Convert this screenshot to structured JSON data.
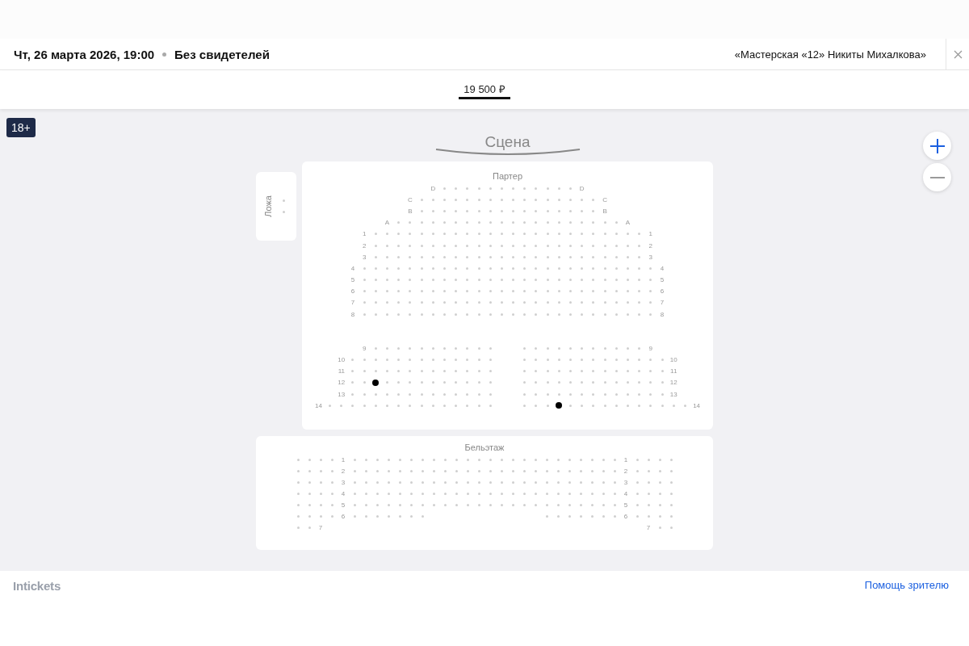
{
  "header": {
    "date": "Чт, 26 марта 2026, 19:00",
    "show": "Без свидетелей",
    "venue": "«Мастерская «12» Никиты Михалкова»"
  },
  "price_tabs": [
    {
      "label": "19 500 ₽",
      "selected": true
    }
  ],
  "age_badge": "18+",
  "stage": "Сцена",
  "loge": {
    "title": "Ложа",
    "seats": [
      false,
      false
    ]
  },
  "sections": [
    {
      "title": "Партер",
      "groups": [
        {
          "rows": [
            {
              "cells": [
                "D",
                false,
                false,
                false,
                false,
                false,
                false,
                false,
                false,
                false,
                false,
                false,
                false,
                "D"
              ]
            },
            {
              "cells": [
                "C",
                false,
                false,
                false,
                false,
                false,
                false,
                false,
                false,
                false,
                false,
                false,
                false,
                false,
                false,
                false,
                false,
                "C"
              ]
            },
            {
              "cells": [
                "B",
                false,
                false,
                false,
                false,
                false,
                false,
                false,
                false,
                false,
                false,
                false,
                false,
                false,
                false,
                false,
                false,
                "B"
              ]
            },
            {
              "cells": [
                "A",
                false,
                false,
                false,
                false,
                false,
                false,
                false,
                false,
                false,
                false,
                false,
                false,
                false,
                false,
                false,
                false,
                false,
                false,
                false,
                false,
                "A"
              ]
            },
            {
              "cells": [
                "1",
                false,
                false,
                false,
                false,
                false,
                false,
                false,
                false,
                false,
                false,
                false,
                false,
                false,
                false,
                false,
                false,
                false,
                false,
                false,
                false,
                false,
                false,
                false,
                false,
                "1"
              ]
            },
            {
              "cells": [
                "2",
                false,
                false,
                false,
                false,
                false,
                false,
                false,
                false,
                false,
                false,
                false,
                false,
                false,
                false,
                false,
                false,
                false,
                false,
                false,
                false,
                false,
                false,
                false,
                false,
                "2"
              ]
            },
            {
              "cells": [
                "3",
                false,
                false,
                false,
                false,
                false,
                false,
                false,
                false,
                false,
                false,
                false,
                false,
                false,
                false,
                false,
                false,
                false,
                false,
                false,
                false,
                false,
                false,
                false,
                false,
                "3"
              ]
            },
            {
              "cells": [
                "4",
                false,
                false,
                false,
                false,
                false,
                false,
                false,
                false,
                false,
                false,
                false,
                false,
                false,
                false,
                false,
                false,
                false,
                false,
                false,
                false,
                false,
                false,
                false,
                false,
                false,
                false,
                "4"
              ]
            },
            {
              "cells": [
                "5",
                false,
                false,
                false,
                false,
                false,
                false,
                false,
                false,
                false,
                false,
                false,
                false,
                false,
                false,
                false,
                false,
                false,
                false,
                false,
                false,
                false,
                false,
                false,
                false,
                false,
                false,
                "5"
              ]
            },
            {
              "cells": [
                "6",
                false,
                false,
                false,
                false,
                false,
                false,
                false,
                false,
                false,
                false,
                false,
                false,
                false,
                false,
                false,
                false,
                false,
                false,
                false,
                false,
                false,
                false,
                false,
                false,
                false,
                false,
                "6"
              ]
            },
            {
              "cells": [
                "7",
                false,
                false,
                false,
                false,
                false,
                false,
                false,
                false,
                false,
                false,
                false,
                false,
                false,
                false,
                false,
                false,
                false,
                false,
                false,
                false,
                false,
                false,
                false,
                false,
                false,
                false,
                "7"
              ]
            },
            {
              "cells": [
                "8",
                false,
                false,
                false,
                false,
                false,
                false,
                false,
                false,
                false,
                false,
                false,
                false,
                false,
                false,
                false,
                false,
                false,
                false,
                false,
                false,
                false,
                false,
                false,
                false,
                false,
                false,
                "8"
              ]
            }
          ]
        },
        {
          "rows": [
            {
              "cells": [
                "9",
                false,
                false,
                false,
                false,
                false,
                false,
                false,
                false,
                false,
                false,
                false,
                null,
                null,
                false,
                false,
                false,
                false,
                false,
                false,
                false,
                false,
                false,
                false,
                false,
                "9"
              ]
            },
            {
              "cells": [
                "10",
                false,
                false,
                false,
                false,
                false,
                false,
                false,
                false,
                false,
                false,
                false,
                false,
                false,
                null,
                null,
                false,
                false,
                false,
                false,
                false,
                false,
                false,
                false,
                false,
                false,
                false,
                false,
                false,
                "10"
              ]
            },
            {
              "cells": [
                "11",
                false,
                false,
                false,
                false,
                false,
                false,
                false,
                false,
                false,
                false,
                false,
                false,
                false,
                null,
                null,
                false,
                false,
                false,
                false,
                false,
                false,
                false,
                false,
                false,
                false,
                false,
                false,
                false,
                "11"
              ]
            },
            {
              "cells": [
                "12",
                false,
                false,
                true,
                false,
                false,
                false,
                false,
                false,
                false,
                false,
                false,
                false,
                false,
                null,
                null,
                false,
                false,
                false,
                false,
                false,
                false,
                false,
                false,
                false,
                false,
                false,
                false,
                false,
                "12"
              ]
            },
            {
              "cells": [
                "13",
                false,
                false,
                false,
                false,
                false,
                false,
                false,
                false,
                false,
                false,
                false,
                false,
                false,
                null,
                null,
                false,
                false,
                false,
                false,
                false,
                false,
                false,
                false,
                false,
                false,
                false,
                false,
                false,
                "13"
              ]
            },
            {
              "cells": [
                "14",
                false,
                false,
                false,
                false,
                false,
                false,
                false,
                false,
                false,
                false,
                false,
                false,
                false,
                false,
                false,
                null,
                null,
                false,
                false,
                false,
                true,
                false,
                false,
                false,
                false,
                false,
                false,
                false,
                false,
                false,
                false,
                false,
                "14"
              ]
            }
          ]
        }
      ]
    },
    {
      "title": "Бельэтаж",
      "groups": [
        {
          "rows": [
            {
              "cells": [
                false,
                false,
                false,
                false,
                "1",
                false,
                false,
                false,
                false,
                false,
                false,
                false,
                false,
                false,
                false,
                false,
                false,
                false,
                false,
                false,
                false,
                false,
                false,
                false,
                false,
                false,
                false,
                false,
                false,
                "1",
                false,
                false,
                false,
                false
              ]
            },
            {
              "cells": [
                false,
                false,
                false,
                false,
                "2",
                false,
                false,
                false,
                false,
                false,
                false,
                false,
                false,
                false,
                false,
                false,
                false,
                false,
                false,
                false,
                false,
                false,
                false,
                false,
                false,
                false,
                false,
                false,
                false,
                "2",
                false,
                false,
                false,
                false
              ]
            },
            {
              "cells": [
                false,
                false,
                false,
                false,
                "3",
                false,
                false,
                false,
                false,
                false,
                false,
                false,
                false,
                false,
                false,
                false,
                false,
                false,
                false,
                false,
                false,
                false,
                false,
                false,
                false,
                false,
                false,
                false,
                false,
                "3",
                false,
                false,
                false,
                false
              ]
            },
            {
              "cells": [
                false,
                false,
                false,
                false,
                "4",
                false,
                false,
                false,
                false,
                false,
                false,
                false,
                false,
                false,
                false,
                false,
                false,
                false,
                false,
                false,
                false,
                false,
                false,
                false,
                false,
                false,
                false,
                false,
                false,
                "4",
                false,
                false,
                false,
                false
              ]
            },
            {
              "cells": [
                false,
                false,
                false,
                false,
                "5",
                false,
                false,
                false,
                false,
                false,
                false,
                false,
                false,
                false,
                false,
                false,
                false,
                false,
                false,
                false,
                false,
                false,
                false,
                false,
                false,
                false,
                false,
                false,
                false,
                "5",
                false,
                false,
                false,
                false
              ]
            },
            {
              "cells": [
                false,
                false,
                false,
                false,
                "6",
                false,
                false,
                false,
                false,
                false,
                false,
                false,
                null,
                null,
                null,
                null,
                null,
                null,
                null,
                null,
                null,
                null,
                false,
                false,
                false,
                false,
                false,
                false,
                false,
                "6",
                false,
                false,
                false,
                false
              ]
            },
            {
              "cells": [
                false,
                false,
                "7",
                null,
                null,
                null,
                null,
                null,
                null,
                null,
                null,
                null,
                null,
                null,
                null,
                null,
                null,
                null,
                null,
                null,
                null,
                null,
                null,
                null,
                null,
                null,
                null,
                null,
                null,
                null,
                null,
                "7",
                false,
                false
              ]
            }
          ]
        }
      ]
    }
  ],
  "footer": {
    "logo": "Intickets",
    "help_link": "Помощь зрителю"
  }
}
